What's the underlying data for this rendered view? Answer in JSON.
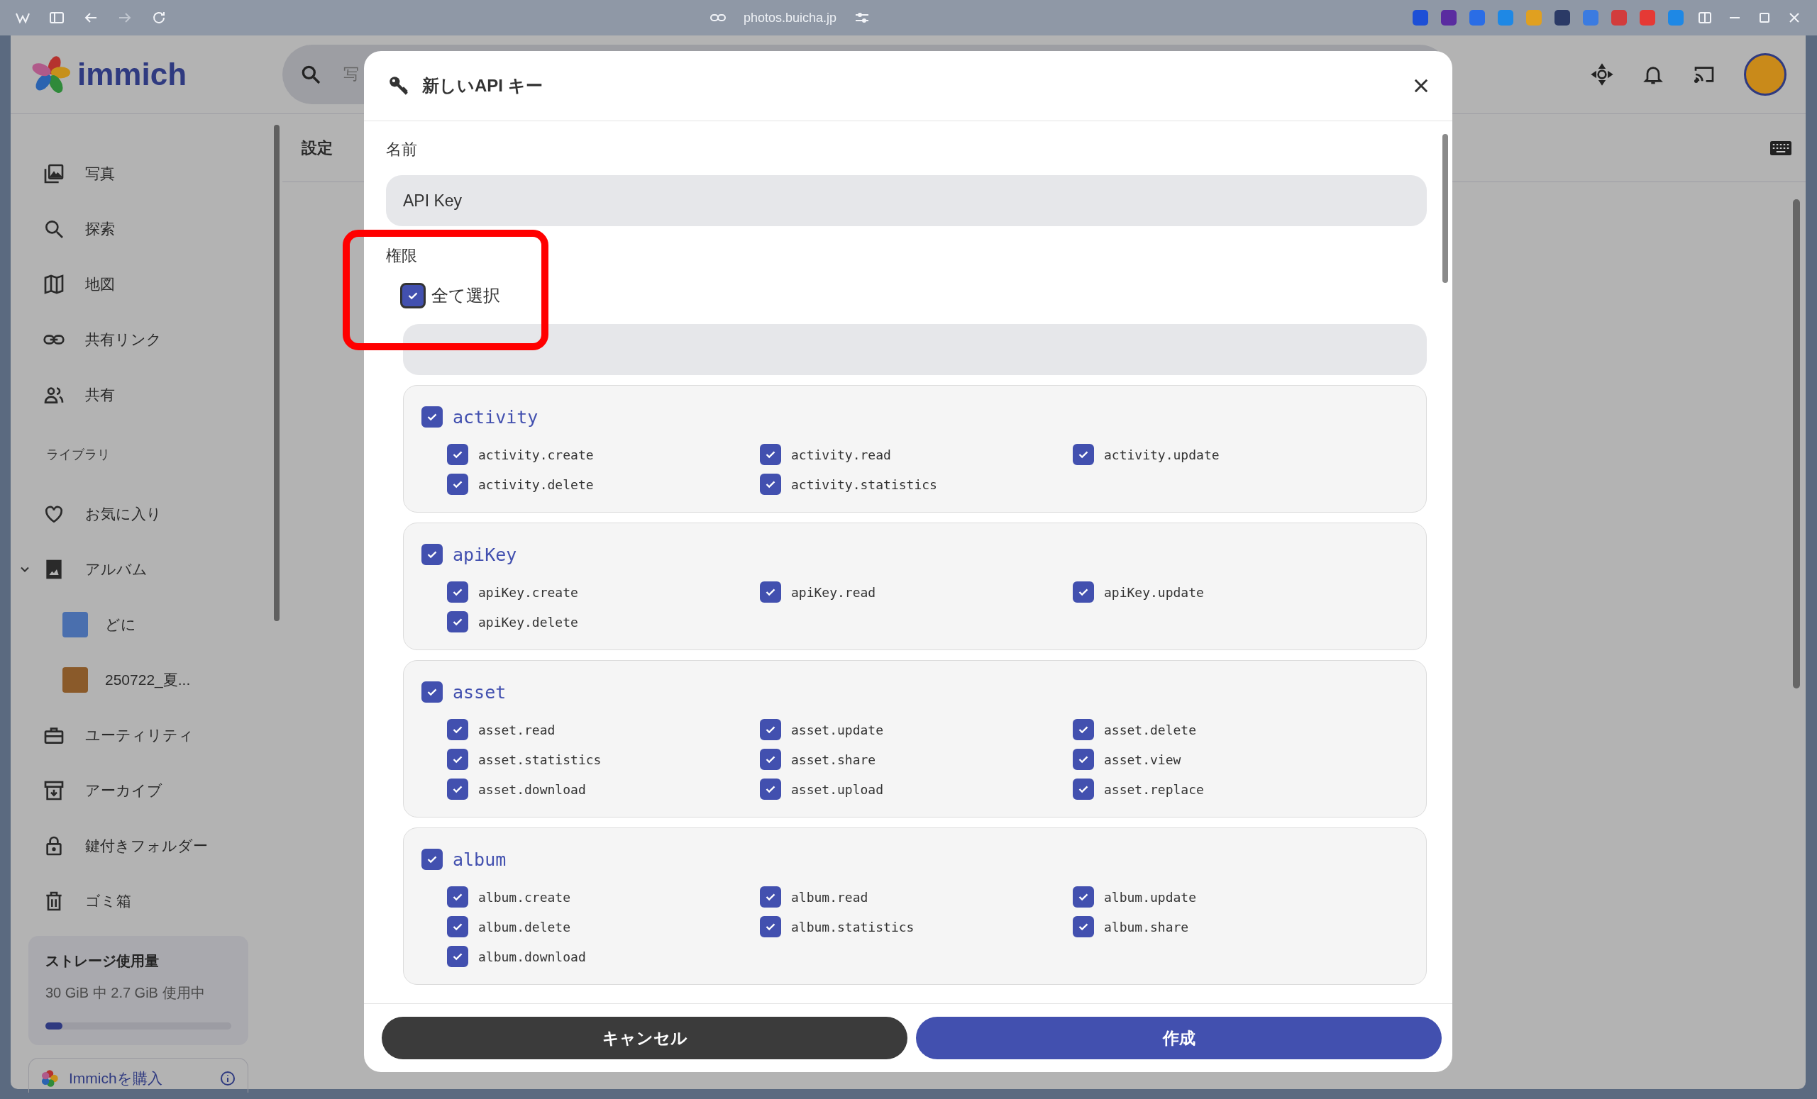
{
  "browser": {
    "url": "photos.buicha.jp"
  },
  "header": {
    "logo": "immich",
    "search_placeholder": "写"
  },
  "sidebar": {
    "items": [
      {
        "label": "写真",
        "kind": "photos",
        "selected": false
      },
      {
        "label": "探索",
        "kind": "search",
        "selected": false
      },
      {
        "label": "地図",
        "kind": "map",
        "selected": false
      },
      {
        "label": "共有リンク",
        "kind": "link",
        "selected": false
      },
      {
        "label": "共有",
        "kind": "people",
        "selected": false
      }
    ],
    "section_label": "ライブラリ",
    "library_items": [
      {
        "label": "お気に入り",
        "kind": "heart"
      },
      {
        "label": "アルバム",
        "kind": "album",
        "expanded": true,
        "children": [
          {
            "label": "どに"
          },
          {
            "label": "250722_夏..."
          }
        ]
      },
      {
        "label": "ユーティリティ",
        "kind": "toolbox"
      },
      {
        "label": "アーカイブ",
        "kind": "archive"
      },
      {
        "label": "鍵付きフォルダー",
        "kind": "lock"
      },
      {
        "label": "ゴミ箱",
        "kind": "trash"
      }
    ],
    "storage": {
      "title": "ストレージ使用量",
      "text": "30 GiB 中 2.7 GiB 使用中",
      "level": 0.09
    },
    "purchase": "Immichを購入"
  },
  "page": {
    "title": "設定"
  },
  "dialog": {
    "title": "新しいAPI キー",
    "name_label": "名前",
    "name_value": "API Key",
    "permissions_label": "権限",
    "select_all": {
      "label": "全て選択",
      "checked": true
    },
    "groups": [
      {
        "name": "activity",
        "checked": true,
        "permissions": [
          {
            "name": "activity.create",
            "checked": true
          },
          {
            "name": "activity.read",
            "checked": true
          },
          {
            "name": "activity.update",
            "checked": true
          },
          {
            "name": "activity.delete",
            "checked": true
          },
          {
            "name": "activity.statistics",
            "checked": true
          }
        ]
      },
      {
        "name": "apiKey",
        "checked": true,
        "permissions": [
          {
            "name": "apiKey.create",
            "checked": true
          },
          {
            "name": "apiKey.read",
            "checked": true
          },
          {
            "name": "apiKey.update",
            "checked": true
          },
          {
            "name": "apiKey.delete",
            "checked": true
          }
        ]
      },
      {
        "name": "asset",
        "checked": true,
        "permissions": [
          {
            "name": "asset.read",
            "checked": true
          },
          {
            "name": "asset.update",
            "checked": true
          },
          {
            "name": "asset.delete",
            "checked": true
          },
          {
            "name": "asset.statistics",
            "checked": true
          },
          {
            "name": "asset.share",
            "checked": true
          },
          {
            "name": "asset.view",
            "checked": true
          },
          {
            "name": "asset.download",
            "checked": true
          },
          {
            "name": "asset.upload",
            "checked": true
          },
          {
            "name": "asset.replace",
            "checked": true
          }
        ]
      },
      {
        "name": "album",
        "checked": true,
        "permissions": [
          {
            "name": "album.create",
            "checked": true
          },
          {
            "name": "album.read",
            "checked": true
          },
          {
            "name": "album.update",
            "checked": true
          },
          {
            "name": "album.delete",
            "checked": true
          },
          {
            "name": "album.statistics",
            "checked": true
          },
          {
            "name": "album.share",
            "checked": true
          },
          {
            "name": "album.download",
            "checked": true
          }
        ]
      }
    ],
    "buttons": [
      {
        "label": "キャンセル",
        "kind": "secondary"
      },
      {
        "label": "作成",
        "kind": "primary"
      }
    ]
  }
}
